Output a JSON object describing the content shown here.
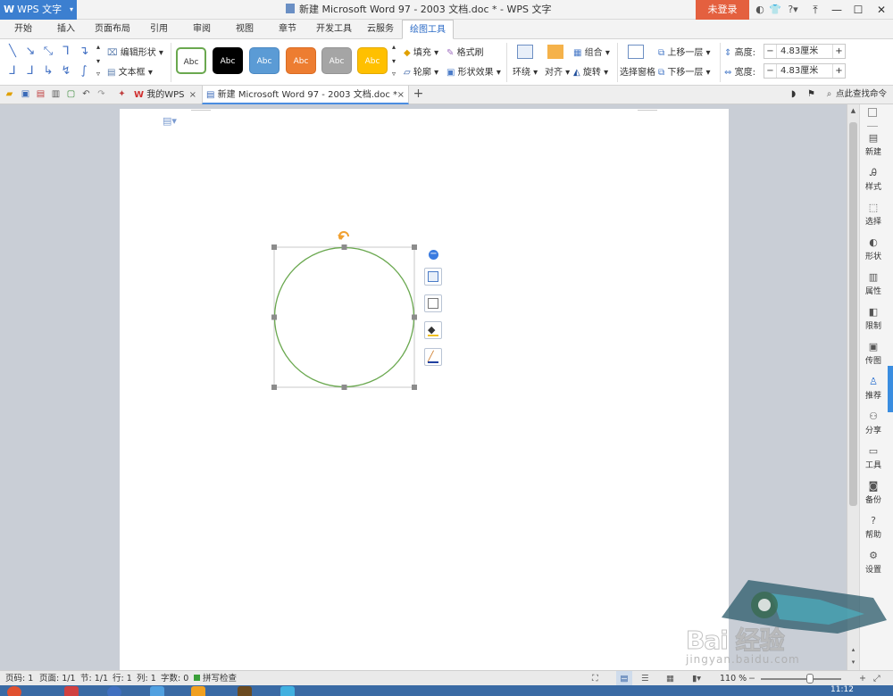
{
  "titlebar": {
    "app_button": "WPS 文字",
    "doc_title": "新建 Microsoft Word 97 - 2003 文档.doc * - WPS 文字",
    "login": "未登录"
  },
  "tabs": [
    "开始",
    "插入",
    "页面布局",
    "引用",
    "审阅",
    "视图",
    "章节",
    "开发工具",
    "云服务",
    "绘图工具"
  ],
  "active_tab": "绘图工具",
  "ribbon": {
    "edit_shape": "编辑形状",
    "text_box": "文本框",
    "style_swatches": [
      {
        "label": "Abc",
        "bg": "#ffffff",
        "fg": "#333333",
        "border": "#6aa84f"
      },
      {
        "label": "Abc",
        "bg": "#000000",
        "fg": "#ffffff",
        "border": "#000000"
      },
      {
        "label": "Abc",
        "bg": "#5b9bd5",
        "fg": "#ffffff",
        "border": "#4a88c2"
      },
      {
        "label": "Abc",
        "bg": "#ed7d31",
        "fg": "#ffffff",
        "border": "#d96b23"
      },
      {
        "label": "Abc",
        "bg": "#a5a5a5",
        "fg": "#ffffff",
        "border": "#939393"
      },
      {
        "label": "Abc",
        "bg": "#ffc000",
        "fg": "#ffffff",
        "border": "#e2a900"
      }
    ],
    "fill": "填充",
    "format_brush": "格式刷",
    "outline": "轮廓",
    "shape_effect": "形状效果",
    "wrap": "环绕",
    "align": "对齐",
    "group": "组合",
    "rotate": "旋转",
    "selection_pane": "选择窗格",
    "bring_forward": "上移一层",
    "send_backward": "下移一层",
    "height_label": "高度:",
    "height_value": "4.83厘米",
    "width_label": "宽度:",
    "width_value": "4.83厘米"
  },
  "doc_tabs": {
    "tab1": "我的WPS",
    "tab2": "新建 Microsoft Word 97 - 2003 文档.doc *",
    "search": "点此查找命令"
  },
  "shape": {
    "type": "circle",
    "stroke_color": "#6aa84f",
    "handle_color": "#8c8c8c",
    "rotate_color": "#f0a030"
  },
  "right_panel": [
    "新建",
    "样式",
    "选择",
    "形状",
    "属性",
    "限制",
    "传图",
    "推荐",
    "分享",
    "工具",
    "备份",
    "帮助",
    "设置"
  ],
  "statusbar": {
    "page_num": "页码: 1",
    "pages": "页面: 1/1",
    "section": "节: 1/1",
    "row": "行: 1",
    "col": "列: 1",
    "words": "字数: 0",
    "spellcheck": "拼写检查",
    "zoom": "110 %"
  },
  "clock": "11:12",
  "watermark": {
    "text": "Bai 经验",
    "sub": "jingyan.baidu.com"
  }
}
